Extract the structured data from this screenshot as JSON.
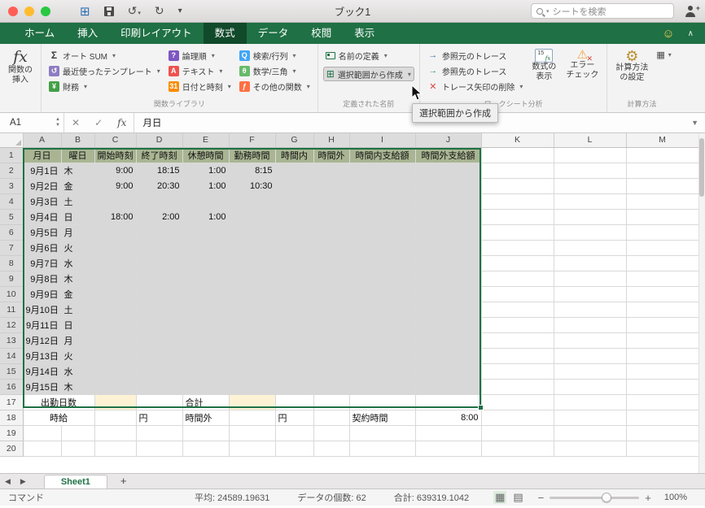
{
  "colors": {
    "accent_green": "#1e7145",
    "tab_bar_green": "#1f7044",
    "tab_selected_green": "#11492b",
    "selection_fill": "#d8d8d8",
    "header_row_fill": "#a9b592",
    "input_highlight_yellow": "#fdf3d4"
  },
  "titlebar": {
    "title": "ブック1",
    "search_placeholder": "シートを検索"
  },
  "tabbar": {
    "tabs": [
      "ホーム",
      "挿入",
      "印刷レイアウト",
      "数式",
      "データ",
      "校閲",
      "表示"
    ]
  },
  "ribbon": {
    "insert_function": {
      "icon_text": "fx",
      "line1": "関数の",
      "line2": "挿入"
    },
    "function_library": {
      "label": "関数ライブラリ",
      "items": [
        {
          "label": "オート SUM",
          "icon": "autosum-icon",
          "glyph": "Σ",
          "bg": ""
        },
        {
          "label": "最近使ったテンプレート",
          "icon": "recent-functions-icon",
          "glyph": "↺",
          "bg": "#8e7cc3"
        },
        {
          "label": "財務",
          "icon": "financial-icon",
          "glyph": "¥",
          "bg": "#43a047"
        },
        {
          "label": "論理順",
          "icon": "logical-icon",
          "glyph": "?",
          "bg": "#7e57c2"
        },
        {
          "label": "テキスト",
          "icon": "text-icon",
          "glyph": "A",
          "bg": "#ef5350"
        },
        {
          "label": "日付と時刻",
          "icon": "date-time-icon",
          "glyph": "31",
          "bg": "#fb8c00"
        },
        {
          "label": "検索/行列",
          "icon": "lookup-reference-icon",
          "glyph": "Q",
          "bg": "#42a5f5"
        },
        {
          "label": "数学/三角",
          "icon": "math-trig-icon",
          "glyph": "θ",
          "bg": "#66bb6a"
        },
        {
          "label": "その他の関数",
          "icon": "more-functions-icon",
          "glyph": "ƒ",
          "bg": "#ff7043"
        }
      ]
    },
    "defined_names": {
      "label": "定義された名前",
      "define_name": "名前の定義",
      "create_from_selection": "選択範囲から作成"
    },
    "auditing": {
      "label": "ワークシート分析",
      "items": [
        {
          "label": "参照元のトレース",
          "icon": "trace-precedents-icon",
          "glyph": "→",
          "color": "#2f6fb2",
          "dd": false
        },
        {
          "label": "参照先のトレース",
          "icon": "trace-dependents-icon",
          "glyph": "→",
          "color": "#2f9e69",
          "dd": false
        },
        {
          "label": "トレース矢印の削除",
          "icon": "remove-arrows-icon",
          "glyph": "✕",
          "color": "#d64541",
          "dd": true
        }
      ],
      "show_formulas": {
        "line1": "数式の",
        "line2": "表示",
        "icon_num": "15",
        "icon_fx": "fx"
      },
      "error_check": {
        "line1": "エラー",
        "line2": "チェック"
      }
    },
    "calculation": {
      "label": "計算方法",
      "line1": "計算方法",
      "line2": "の設定"
    },
    "tooltip": "選択範囲から作成"
  },
  "formula_bar": {
    "name_box": "A1",
    "content": "月日"
  },
  "grid": {
    "columns": [
      "A",
      "B",
      "C",
      "D",
      "E",
      "F",
      "G",
      "H",
      "I",
      "J",
      "K",
      "L",
      "M"
    ],
    "header_row": [
      "月日",
      "曜日",
      "開始時刻",
      "終了時刻",
      "休憩時間",
      "勤務時間",
      "時間内",
      "時間外",
      "時間内支給額",
      "時間外支給額"
    ],
    "day_rows": [
      {
        "date": "9月1日",
        "dow": "木",
        "vals": [
          "9:00",
          "18:15",
          "1:00",
          "8:15"
        ]
      },
      {
        "date": "9月2日",
        "dow": "金",
        "vals": [
          "9:00",
          "20:30",
          "1:00",
          "10:30"
        ]
      },
      {
        "date": "9月3日",
        "dow": "土",
        "vals": []
      },
      {
        "date": "9月4日",
        "dow": "日",
        "vals": [
          "18:00",
          "2:00",
          "1:00"
        ]
      },
      {
        "date": "9月5日",
        "dow": "月",
        "vals": []
      },
      {
        "date": "9月6日",
        "dow": "火",
        "vals": []
      },
      {
        "date": "9月7日",
        "dow": "水",
        "vals": []
      },
      {
        "date": "9月8日",
        "dow": "木",
        "vals": []
      },
      {
        "date": "9月9日",
        "dow": "金",
        "vals": []
      },
      {
        "date": "9月10日",
        "dow": "土",
        "vals": []
      },
      {
        "date": "9月11日",
        "dow": "日",
        "vals": []
      },
      {
        "date": "9月12日",
        "dow": "月",
        "vals": []
      },
      {
        "date": "9月13日",
        "dow": "火",
        "vals": []
      },
      {
        "date": "9月14日",
        "dow": "水",
        "vals": []
      },
      {
        "date": "9月15日",
        "dow": "木",
        "vals": []
      }
    ],
    "footer": {
      "attendance_label": "出勤日数",
      "total_label": "合計",
      "wage_label": "時給",
      "yen_1": "円",
      "overtime_label": "時間外",
      "yen_2": "円",
      "contract_label": "契約時間",
      "contract_value": "8:00"
    }
  },
  "sheet_bar": {
    "tabs": [
      "Sheet1"
    ],
    "add_label": "+"
  },
  "status_bar": {
    "mode": "コマンド",
    "average": "平均: 24589.19631",
    "count": "データの個数: 62",
    "sum": "合計: 639319.1042",
    "zoom": "100%"
  }
}
